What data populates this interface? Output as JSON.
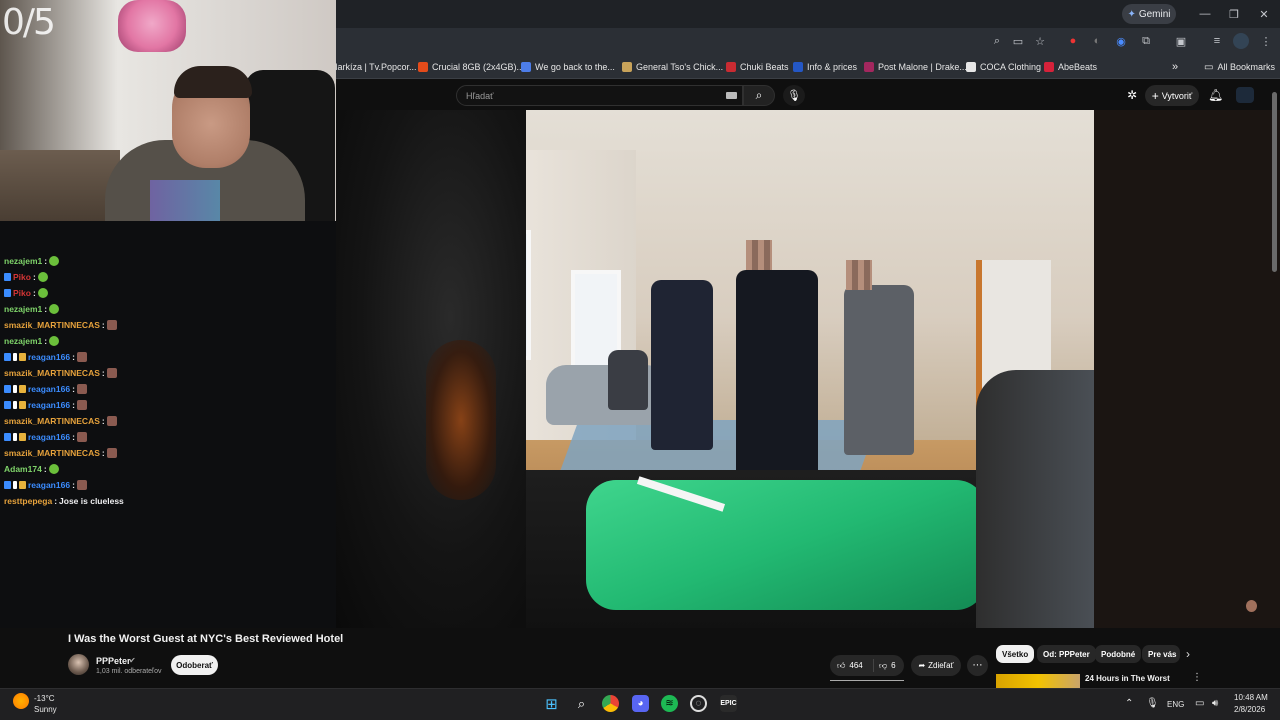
{
  "browser": {
    "gemini_label": "Gemini",
    "bookmarks": [
      {
        "label": "Markíza | Tv.Popcor...",
        "color": "#5b6a7a"
      },
      {
        "label": "Crucial 8GB (2x4GB)...",
        "color": "#e44b1a"
      },
      {
        "label": "We go back to the...",
        "color": "#4d7de8"
      },
      {
        "label": "General Tso's Chick...",
        "color": "#c8a35a"
      },
      {
        "label": "Chuki Beats",
        "color": "#c92b32"
      },
      {
        "label": "Info & prices",
        "color": "#2457c5"
      },
      {
        "label": "Post Malone | Drake...",
        "color": "#a3275e"
      },
      {
        "label": "COCA Clothing",
        "color": "#e6e6e6"
      },
      {
        "label": "AbeBeats",
        "color": "#d6223a"
      }
    ],
    "all_bookmarks": "All Bookmarks"
  },
  "youtube": {
    "search_placeholder": "Hľadať",
    "create_label": "Vytvoriť"
  },
  "video": {
    "title": "I Was the Worst Guest at NYC's Best Reviewed Hotel",
    "channel": "PPPeter",
    "subscribers": "1,03 mil. odberateľov",
    "subscribe_label": "Odoberať",
    "likes": "464",
    "dislikes": "6",
    "share_label": "Zdieľať"
  },
  "chips": [
    "Všetko",
    "Od: PPPeter",
    "Podobné",
    "Pre vás"
  ],
  "recommendation": {
    "title": "24 Hours in The Worst"
  },
  "stream": {
    "counter": "0/5"
  },
  "chat": [
    {
      "user": "nezajem1",
      "color": "#7fd46a",
      "badges": [],
      "emote": "check"
    },
    {
      "user": "Piko",
      "color": "#d43535",
      "badges": [
        "blue"
      ],
      "emote": "check"
    },
    {
      "user": "Piko",
      "color": "#d43535",
      "badges": [
        "blue"
      ],
      "emote": "check"
    },
    {
      "user": "nezajem1",
      "color": "#7fd46a",
      "badges": [],
      "emote": "check"
    },
    {
      "user": "smazik_MARTINNECAS",
      "color": "#e6a23c",
      "badges": [],
      "emote": "face"
    },
    {
      "user": "nezajem1",
      "color": "#7fd46a",
      "badges": [],
      "emote": "check"
    },
    {
      "user": "reagan166",
      "color": "#3b8cff",
      "badges": [
        "blue",
        "white",
        "gold"
      ],
      "emote": "face"
    },
    {
      "user": "smazik_MARTINNECAS",
      "color": "#e6a23c",
      "badges": [],
      "emote": "face"
    },
    {
      "user": "reagan166",
      "color": "#3b8cff",
      "badges": [
        "blue",
        "white",
        "gold"
      ],
      "emote": "face"
    },
    {
      "user": "reagan166",
      "color": "#3b8cff",
      "badges": [
        "blue",
        "white",
        "gold"
      ],
      "emote": "face"
    },
    {
      "user": "smazik_MARTINNECAS",
      "color": "#e6a23c",
      "badges": [],
      "emote": "face"
    },
    {
      "user": "reagan166",
      "color": "#3b8cff",
      "badges": [
        "blue",
        "white",
        "gold"
      ],
      "emote": "face"
    },
    {
      "user": "smazik_MARTINNECAS",
      "color": "#e6a23c",
      "badges": [],
      "emote": "face"
    },
    {
      "user": "Adam174",
      "color": "#7fd46a",
      "badges": [],
      "emote": "check"
    },
    {
      "user": "reagan166",
      "color": "#3b8cff",
      "badges": [
        "blue",
        "white",
        "gold"
      ],
      "emote": "face"
    },
    {
      "user": "resttpepega",
      "color": "#e6a23c",
      "badges": [],
      "message": "Jose is clueless"
    }
  ],
  "taskbar": {
    "temperature": "-13°C",
    "condition": "Sunny",
    "language": "ENG",
    "time": "10:48 AM",
    "date": "2/8/2026"
  }
}
